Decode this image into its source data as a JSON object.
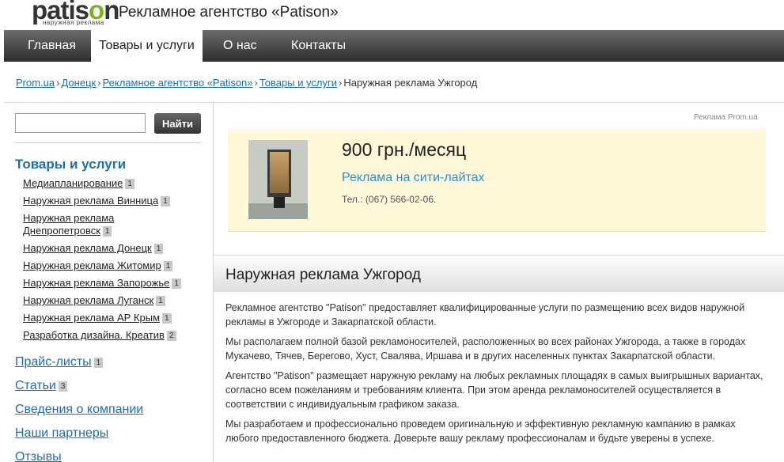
{
  "header": {
    "logo_text_pre": "patis",
    "logo_text_o": "o",
    "logo_text_post": "n",
    "logo_tagline": "наружная реклама",
    "site_title": "Рекламное агентство «Patison»"
  },
  "nav": {
    "items": [
      {
        "label": "Главная"
      },
      {
        "label": "Товары и услуги"
      },
      {
        "label": "О нас"
      },
      {
        "label": "Контакты"
      }
    ]
  },
  "breadcrumbs": {
    "items": [
      {
        "label": "Prom.ua"
      },
      {
        "label": "Донецк"
      },
      {
        "label": "Рекламное агентство «Patison»"
      },
      {
        "label": "Товары и услуги"
      }
    ],
    "separator": "›",
    "current": "Наружная реклама Ужгород"
  },
  "search": {
    "value": "",
    "button_label": "Найти"
  },
  "sidebar": {
    "heading": "Товары и услуги",
    "subitems": [
      {
        "label": "Медиапланирование",
        "count": "1"
      },
      {
        "label": "Наружная реклама Винница",
        "count": "1"
      },
      {
        "label": "Наружная реклама Днепропетровск",
        "count": "1"
      },
      {
        "label": "Наружная реклама Донецк",
        "count": "1"
      },
      {
        "label": "Наружная реклама Житомир",
        "count": "1"
      },
      {
        "label": "Наружная реклама Запорожье",
        "count": "1"
      },
      {
        "label": "Наружная реклама Луганск",
        "count": "1"
      },
      {
        "label": "Наружная реклама АР Крым",
        "count": "1"
      },
      {
        "label": "Разработка дизайна. Креатив",
        "count": "2"
      }
    ],
    "links": [
      {
        "label": "Прайс-листы",
        "count": "1"
      },
      {
        "label": "Статьи",
        "count": "3"
      },
      {
        "label": "Сведения о компании",
        "count": ""
      },
      {
        "label": "Наши партнеры",
        "count": ""
      },
      {
        "label": "Отзывы",
        "count": ""
      }
    ]
  },
  "ad": {
    "label": "Реклама Prom.ua",
    "price": "900 грн./месяц",
    "title": "Реклама на сити-лайтах",
    "phone": "Тел.: (067) 566-02-06."
  },
  "content": {
    "title": "Наружная реклама Ужгород",
    "paragraphs": [
      "Рекламное агентство \"Patison\" предоставляет квалифицированные услуги по размещению всех видов наружной рекламы в Ужгороде и Закарпатской области.",
      "Мы располагаем полной базой рекламоносителей, расположенных во всех районах Ужгорода, а также в городах Мукачево, Тячев, Берегово, Хуст, Свалява, Иршава и в других населенных пунктах Закарпатской области.",
      "Агентство \"Patison\" размещает наружную рекламу на любых рекламных площадях в самых выигрышных вариантах, согласно всем пожеланиям и требованиям клиента. При этом аренда рекламоносителей осуществляется в соответствии с индивидуальным графиком заказа.",
      "Мы разработаем и профессионально проведем оригинальную и эффективную рекламную кампанию в рамках любого предоставленного бюджета. Доверьте вашу рекламу профессионалам и будьте уверены в успехе."
    ]
  },
  "colors": {
    "link": "#1a6fb5",
    "ad_link": "#2a8fc8",
    "ad_bg": "#fff8d9",
    "logo_accent": "#7ab51d"
  }
}
